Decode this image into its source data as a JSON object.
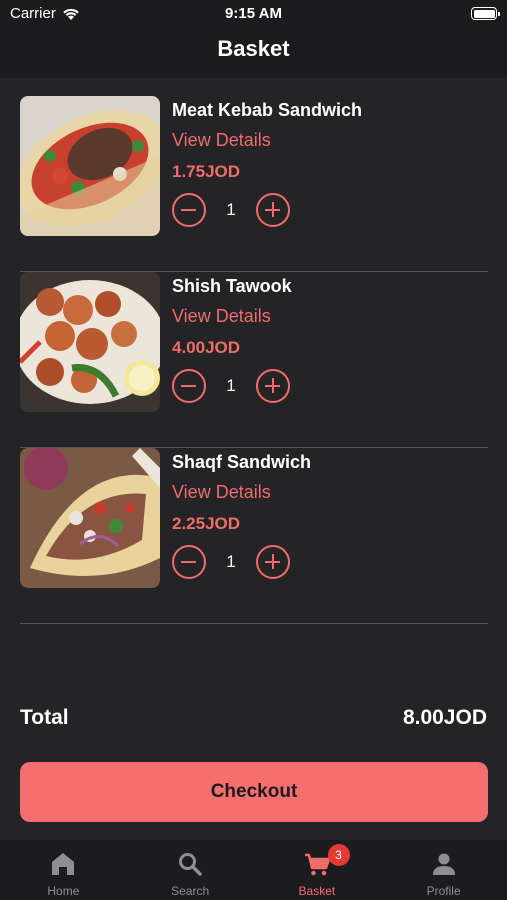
{
  "status_bar": {
    "carrier": "Carrier",
    "time": "9:15 AM"
  },
  "header": {
    "title": "Basket"
  },
  "items": [
    {
      "name": "Meat Kebab Sandwich",
      "details_label": "View Details",
      "price": "1.75JOD",
      "quantity": "1"
    },
    {
      "name": "Shish Tawook",
      "details_label": "View Details",
      "price": "4.00JOD",
      "quantity": "1"
    },
    {
      "name": "Shaqf Sandwich",
      "details_label": "View Details",
      "price": "2.25JOD",
      "quantity": "1"
    }
  ],
  "summary": {
    "total_label": "Total",
    "total_value": "8.00JOD"
  },
  "checkout_label": "Checkout",
  "tabbar": {
    "tabs": [
      {
        "label": "Home",
        "icon": "home-icon"
      },
      {
        "label": "Search",
        "icon": "search-icon"
      },
      {
        "label": "Basket",
        "icon": "cart-icon",
        "badge": "3",
        "active": true
      },
      {
        "label": "Profile",
        "icon": "profile-icon"
      }
    ]
  },
  "colors": {
    "accent": "#f26b6b",
    "background": "#242427",
    "bar": "#1c1c1e",
    "button": "#f66e6e"
  }
}
